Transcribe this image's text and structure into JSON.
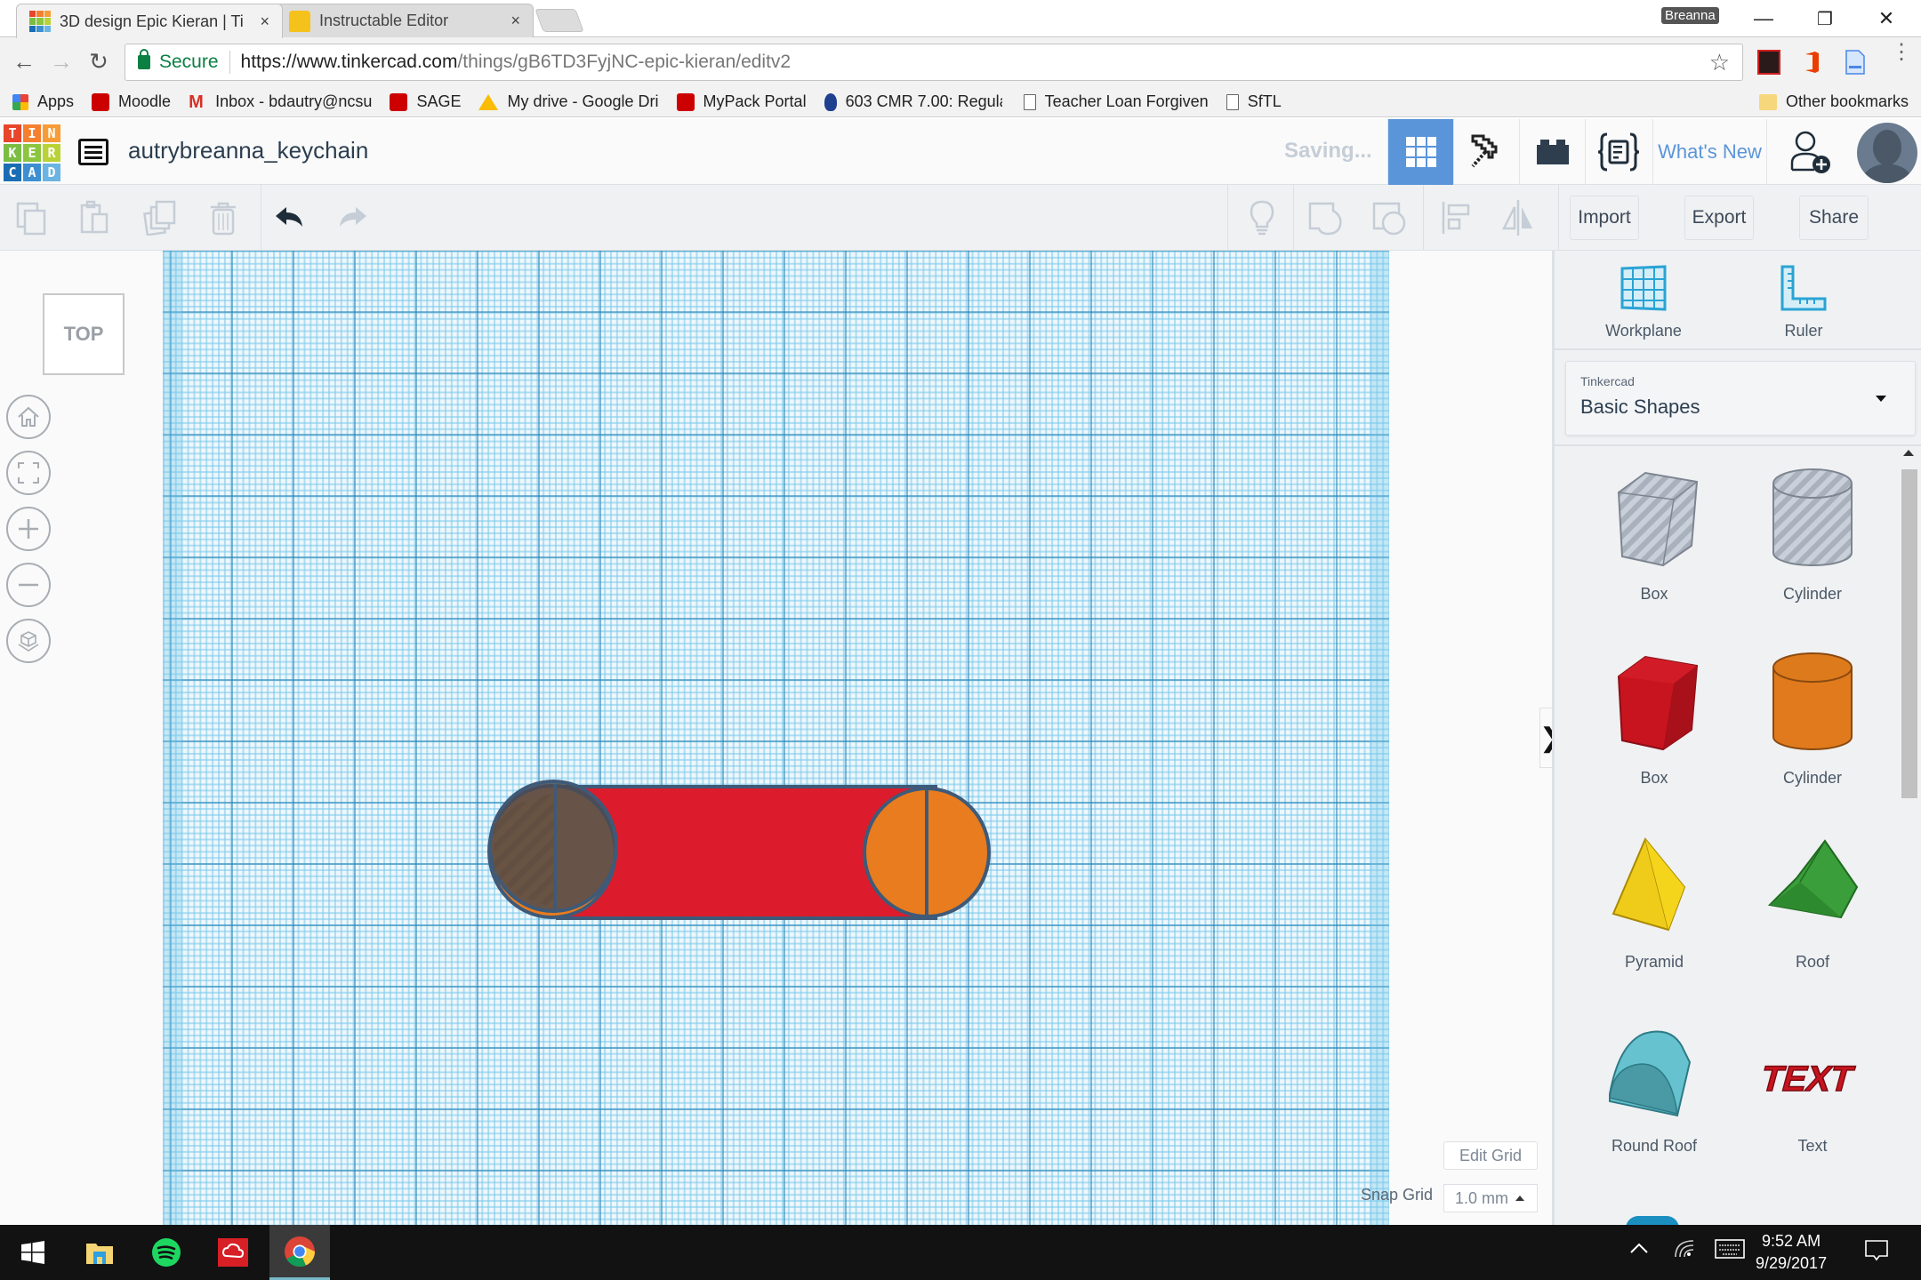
{
  "browser": {
    "tabs": [
      {
        "title": "3D design Epic Kieran | Ti",
        "active": true,
        "close_label": "×"
      },
      {
        "title": "Instructable Editor",
        "active": false,
        "close_label": "×"
      }
    ],
    "profile_name": "Breanna",
    "window_controls": {
      "minimize": "—",
      "restore": "❐",
      "close": "✕"
    },
    "nav": {
      "back": "←",
      "forward": "→",
      "reload": "↻"
    },
    "address": {
      "security_label": "Secure",
      "url_host": "https://www.tinkercad.com",
      "url_path": "/things/gB6TD3FyjNC-epic-kieran/editv2",
      "star": "☆"
    },
    "bookmarks": [
      {
        "label": "Apps",
        "icon": "apps-grid-icon"
      },
      {
        "label": "Moodle",
        "icon": "ncstate-icon"
      },
      {
        "label": "Inbox - bdautry@ncsu",
        "icon": "gmail-icon"
      },
      {
        "label": "SAGE",
        "icon": "ncstate-icon"
      },
      {
        "label": "My drive - Google Dri",
        "icon": "google-drive-icon"
      },
      {
        "label": "MyPack Portal",
        "icon": "ncstate-icon"
      },
      {
        "label": "603 CMR 7.00: Regula",
        "icon": "mass-seal-icon"
      },
      {
        "label": "Teacher Loan Forgiven",
        "icon": "page-icon"
      },
      {
        "label": "SfTL",
        "icon": "page-icon"
      }
    ],
    "other_bookmarks": "Other bookmarks"
  },
  "tinkercad": {
    "logo_letters": [
      "T",
      "I",
      "N",
      "K",
      "E",
      "R",
      "C",
      "A",
      "D"
    ],
    "logo_colors": [
      "#e8452c",
      "#f57f2f",
      "#f79c37",
      "#7bbd43",
      "#8cc63f",
      "#b9d337",
      "#1b6db3",
      "#3d8fd1",
      "#6ab4e2"
    ],
    "design_title": "autrybreanna_keychain",
    "status": "Saving...",
    "whats_new": "What's New",
    "accent_color": "#5b95d9",
    "toolbar": {
      "import": "Import",
      "export": "Export",
      "share": "Share"
    },
    "view": {
      "viewcube_label": "TOP"
    },
    "grid": {
      "edit_grid": "Edit Grid",
      "snap_label": "Snap Grid",
      "snap_value": "1.0 mm"
    },
    "panel": {
      "tools": [
        {
          "label": "Workplane",
          "icon": "workplane-icon"
        },
        {
          "label": "Ruler",
          "icon": "ruler-icon"
        }
      ],
      "library_source": "Tinkercad",
      "library_name": "Basic Shapes",
      "shapes": [
        {
          "label": "Box",
          "kind": "box-hole",
          "color": "#b8bfc9"
        },
        {
          "label": "Cylinder",
          "kind": "cylinder-hole",
          "color": "#b8bfc9"
        },
        {
          "label": "Box",
          "kind": "box",
          "color": "#c8141f"
        },
        {
          "label": "Cylinder",
          "kind": "cylinder",
          "color": "#e07a1c"
        },
        {
          "label": "Pyramid",
          "kind": "pyramid",
          "color": "#f0cc1a"
        },
        {
          "label": "Roof",
          "kind": "roof",
          "color": "#3a9e3a"
        },
        {
          "label": "Round Roof",
          "kind": "roundroof",
          "color": "#66c2cf"
        },
        {
          "label": "Text",
          "kind": "text",
          "color": "#c8141f"
        }
      ]
    },
    "scene_objects": [
      {
        "name": "keychain-body-box",
        "color": "#dc1c2c"
      },
      {
        "name": "left-cylinder",
        "color": "#e87c1e"
      },
      {
        "name": "hole-cylinder",
        "color": "#5a5a5a"
      },
      {
        "name": "right-cylinder",
        "color": "#e87c1e"
      }
    ]
  },
  "taskbar": {
    "apps": [
      "windows-start",
      "file-explorer",
      "spotify",
      "adobe-creative-cloud",
      "google-chrome"
    ],
    "time": "9:52 AM",
    "date": "9/29/2017"
  }
}
